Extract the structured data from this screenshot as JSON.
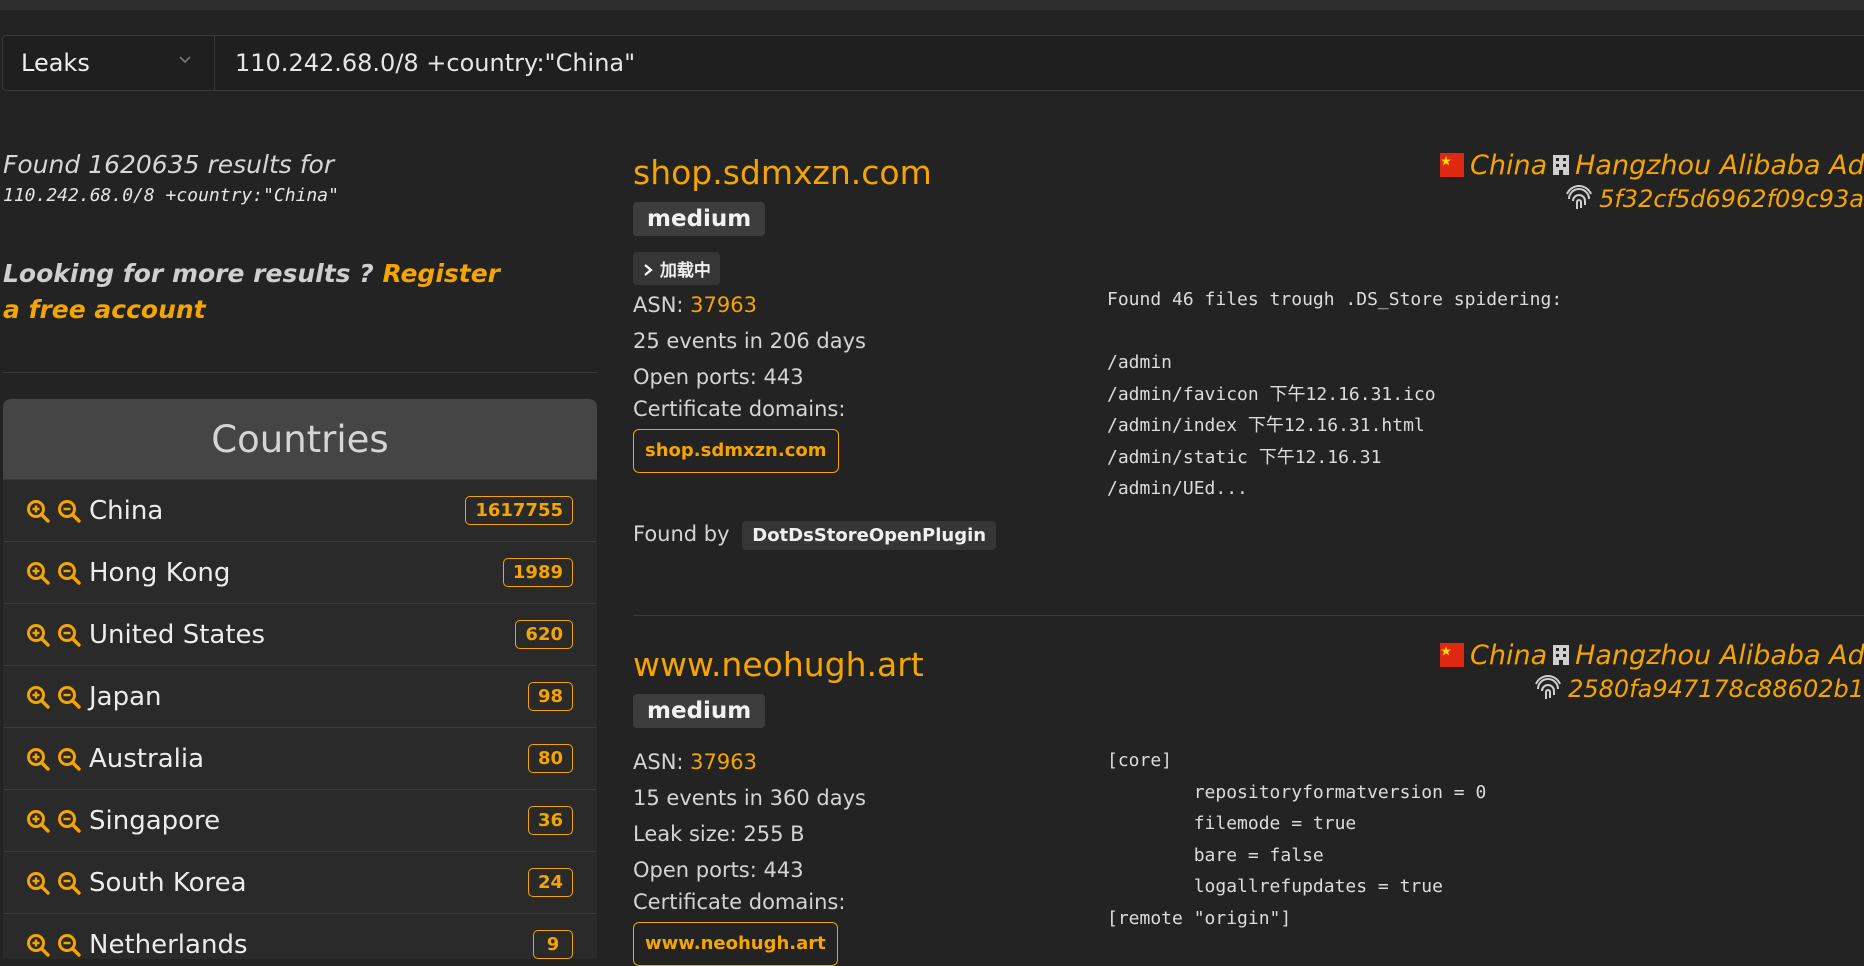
{
  "search": {
    "type_label": "Leaks",
    "query": "110.242.68.0/8 +country:\"China\""
  },
  "summary": {
    "found_text": "Found 1620635 results for",
    "query_text": "110.242.68.0/8 +country:\"China\"",
    "more_prefix": "Looking for more results ?",
    "register_link": "Register a free account"
  },
  "countries": {
    "title": "Countries",
    "items": [
      {
        "name": "China",
        "count": "1617755"
      },
      {
        "name": "Hong Kong",
        "count": "1989"
      },
      {
        "name": "United States",
        "count": "620"
      },
      {
        "name": "Japan",
        "count": "98"
      },
      {
        "name": "Australia",
        "count": "80"
      },
      {
        "name": "Singapore",
        "count": "36"
      },
      {
        "name": "South Korea",
        "count": "24"
      },
      {
        "name": "Netherlands",
        "count": "9"
      }
    ]
  },
  "results": [
    {
      "host": "shop.sdmxzn.com",
      "severity": "medium",
      "loading": "加载中",
      "asn_label": "ASN:",
      "asn": "37963",
      "events": "25 events in 206 days",
      "ports": "Open ports: 443",
      "cert_label": "Certificate domains:",
      "cert_domain": "shop.sdmxzn.com",
      "found_by_label": "Found by",
      "plugin": "DotDsStoreOpenPlugin",
      "country": "China",
      "org": "Hangzhou Alibaba Advertising Co.,Ltd.",
      "hash": "5f32cf5d6962f09c93a",
      "summary": "Found 46 files trough .DS_Store spidering:\n\n/admin\n/admin/favicon 下午12.16.31.ico\n/admin/index 下午12.16.31.html\n/admin/static 下午12.16.31\n/admin/UEd..."
    },
    {
      "host": "www.neohugh.art",
      "severity": "medium",
      "asn_label": "ASN:",
      "asn": "37963",
      "events": "15 events in 360 days",
      "leak_size": "Leak size: 255 B",
      "ports": "Open ports: 443",
      "cert_label": "Certificate domains:",
      "cert_domain": "www.neohugh.art",
      "country": "China",
      "org": "Hangzhou Alibaba Advertising Co.,Ltd.",
      "hash": "2580fa947178c88602b1",
      "summary": "[core]\n        repositoryformatversion = 0\n        filemode = true\n        bare = false\n        logallrefupdates = true\n[remote \"origin\"]"
    }
  ],
  "colors": {
    "accent": "#f5a500",
    "background": "#232323"
  }
}
